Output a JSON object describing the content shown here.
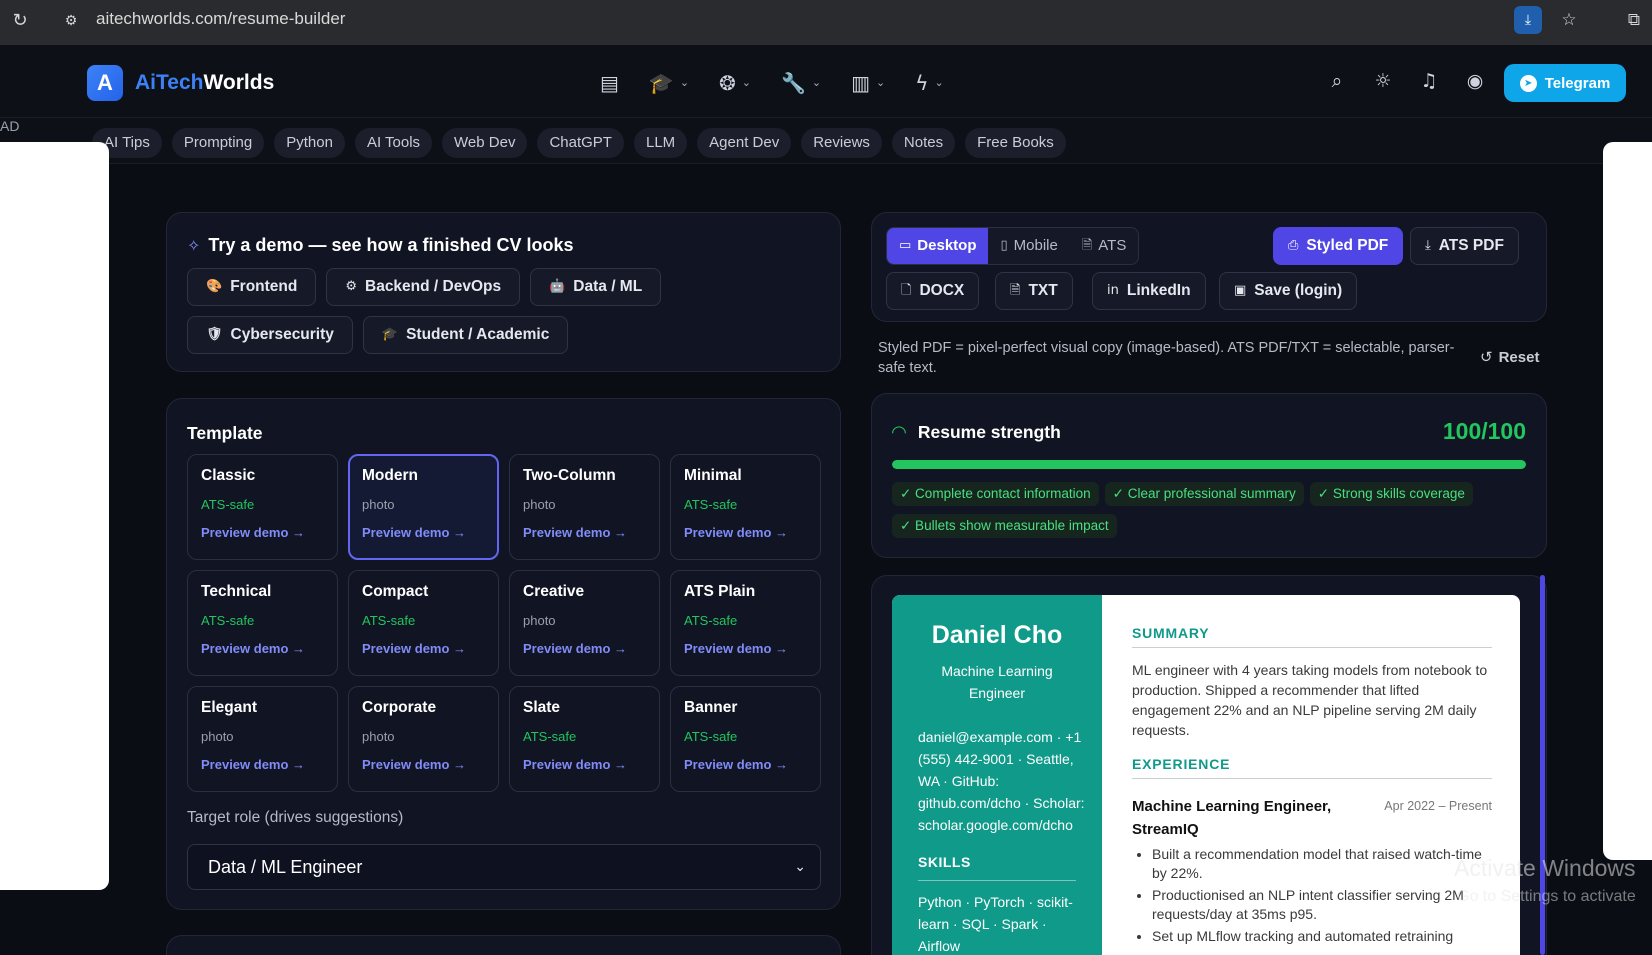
{
  "browser": {
    "url": "aitechworlds.com/resume-builder"
  },
  "brand": {
    "badge": "A",
    "name_part1": "AiTech",
    "name_part2": "Worlds"
  },
  "header": {
    "telegram_label": "Telegram"
  },
  "ad_label": "AD",
  "categories": [
    "AI Tips",
    "Prompting",
    "Python",
    "AI Tools",
    "Web Dev",
    "ChatGPT",
    "LLM",
    "Agent Dev",
    "Reviews",
    "Notes",
    "Free Books"
  ],
  "demo": {
    "title": "Try a demo — see how a finished CV looks",
    "buttons": [
      {
        "emoji": "🎨",
        "label": "Frontend"
      },
      {
        "emoji": "⚙",
        "label": "Backend / DevOps"
      },
      {
        "emoji": "🤖",
        "label": "Data / ML"
      },
      {
        "emoji": "🛡",
        "label": "Cybersecurity"
      },
      {
        "emoji": "🎓",
        "label": "Student / Academic"
      }
    ]
  },
  "templates": {
    "heading": "Template",
    "link_label": "Preview demo →",
    "items": [
      {
        "name": "Classic",
        "tag": "ATS-safe",
        "kind": "safe"
      },
      {
        "name": "Modern",
        "tag": "photo",
        "kind": "photo",
        "selected": true
      },
      {
        "name": "Two-Column",
        "tag": "photo",
        "kind": "photo"
      },
      {
        "name": "Minimal",
        "tag": "ATS-safe",
        "kind": "safe"
      },
      {
        "name": "Technical",
        "tag": "ATS-safe",
        "kind": "safe"
      },
      {
        "name": "Compact",
        "tag": "ATS-safe",
        "kind": "safe"
      },
      {
        "name": "Creative",
        "tag": "photo",
        "kind": "photo"
      },
      {
        "name": "ATS Plain",
        "tag": "ATS-safe",
        "kind": "safe"
      },
      {
        "name": "Elegant",
        "tag": "photo",
        "kind": "photo"
      },
      {
        "name": "Corporate",
        "tag": "photo",
        "kind": "photo"
      },
      {
        "name": "Slate",
        "tag": "ATS-safe",
        "kind": "safe"
      },
      {
        "name": "Banner",
        "tag": "ATS-safe",
        "kind": "safe"
      }
    ],
    "role_label": "Target role (drives suggestions)",
    "role_value": "Data / ML Engineer"
  },
  "view": {
    "tabs": [
      {
        "label": "Desktop",
        "active": true
      },
      {
        "label": "Mobile",
        "active": false
      },
      {
        "label": "ATS",
        "active": false
      }
    ],
    "styled_pdf": "Styled PDF",
    "ats_pdf": "ATS PDF",
    "docx": "DOCX",
    "txt": "TXT",
    "linkedin": "LinkedIn",
    "save": "Save (login)"
  },
  "note": "Styled PDF = pixel-perfect visual copy (image-based). ATS PDF/TXT = selectable, parser-safe text.",
  "reset_label": "Reset",
  "strength": {
    "title": "Resume strength",
    "score": "100/100",
    "fraction": 1.0,
    "checks": [
      "✓ Complete contact information",
      "✓ Clear professional summary",
      "✓ Strong skills coverage",
      "✓ Bullets show measurable impact"
    ]
  },
  "resume": {
    "name": "Daniel Cho",
    "role": "Machine Learning Engineer",
    "contact": "daniel@example.com · +1 (555) 442-9001 · Seattle, WA · GitHub: github.com/dcho · Scholar: scholar.google.com/dcho",
    "skills_heading": "SKILLS",
    "skills": "Python · PyTorch · scikit-learn · SQL · Spark · Airflow",
    "summary_heading": "SUMMARY",
    "summary": "ML engineer with 4 years taking models from notebook to production. Shipped a recommender that lifted engagement 22% and an NLP pipeline serving 2M daily requests.",
    "experience_heading": "EXPERIENCE",
    "job_title": "Machine Learning Engineer, StreamIQ",
    "job_date": "Apr 2022 – Present",
    "bullets": [
      "Built a recommendation model that raised watch-time by 22%.",
      "Productionised an NLP intent classifier serving 2M requests/day at 35ms p95.",
      "Set up MLflow tracking and automated retraining"
    ]
  },
  "os_watermark": {
    "line1": "Activate Windows",
    "line2": "Go to Settings to activate"
  }
}
